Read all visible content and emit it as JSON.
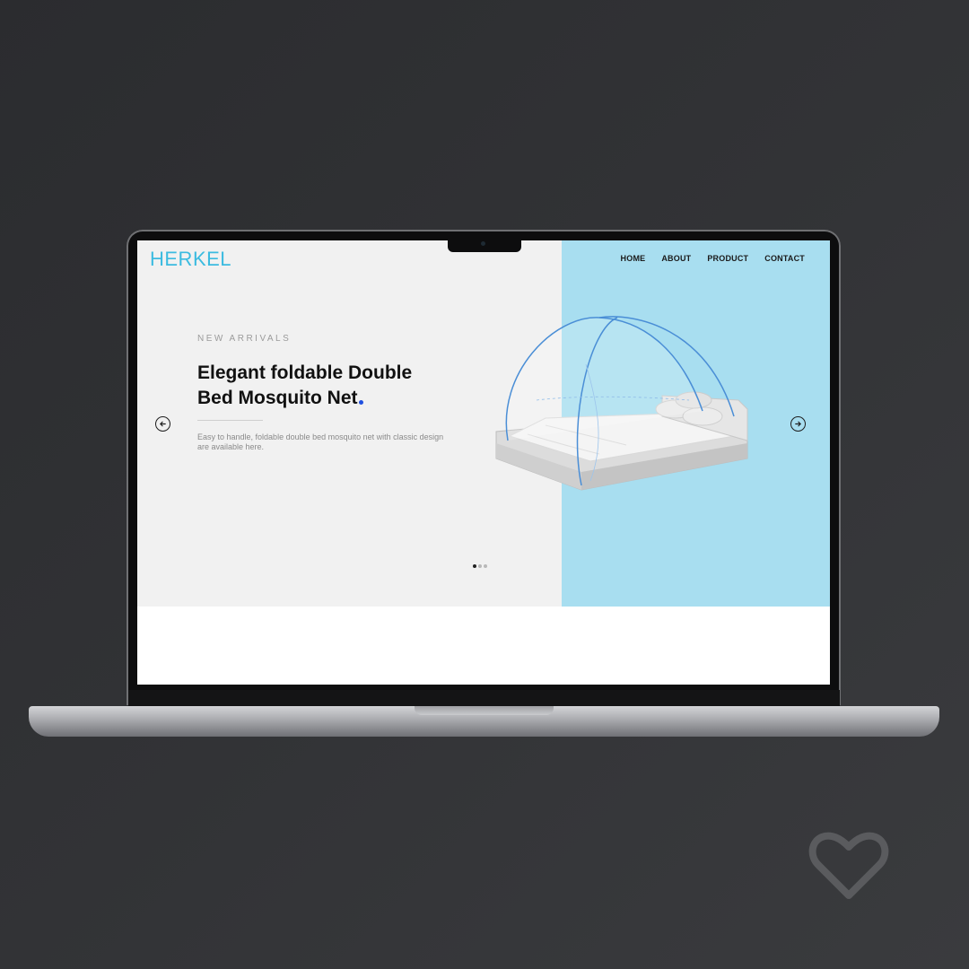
{
  "site": {
    "logo": "HERKEL",
    "nav": [
      "HOME",
      "ABOUT",
      "PRODUCT",
      "CONTACT"
    ]
  },
  "hero": {
    "eyebrow": "NEW ARRIVALS",
    "headline_line1": "Elegant foldable Double",
    "headline_line2": "Bed Mosquito Net",
    "description": "Easy to handle, foldable double bed mosquito net with classic design are available here.",
    "slides": {
      "count": 3,
      "active": 1
    }
  },
  "colors": {
    "brand": "#3bbbe0",
    "hero_right_bg": "#a8def0",
    "hero_left_bg": "#f1f1f1",
    "accent_dot": "#1f4fe0"
  },
  "icons": {
    "prev": "arrow-left-circle-icon",
    "next": "arrow-right-circle-icon",
    "favorite": "heart-icon"
  }
}
